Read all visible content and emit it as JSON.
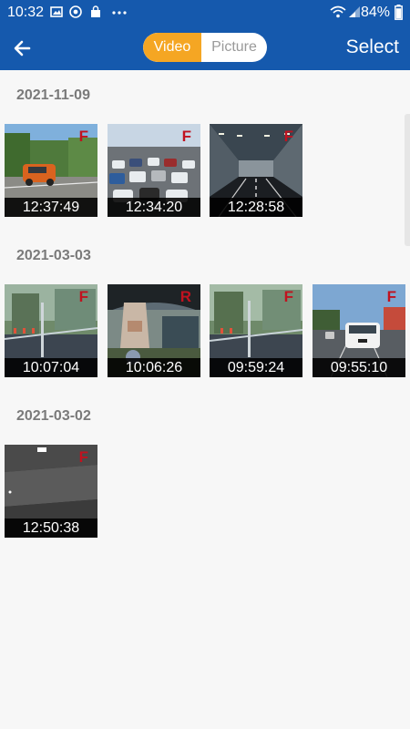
{
  "status": {
    "time": "10:32",
    "battery": "84%"
  },
  "header": {
    "tabs": [
      "Video",
      "Picture"
    ],
    "active_tab": "Video",
    "action": "Select"
  },
  "groups": [
    {
      "date": "2021-11-09",
      "items": [
        {
          "time": "12:37:49",
          "tag": "F",
          "scene": "suburban road with orange SUV"
        },
        {
          "time": "12:34:20",
          "tag": "F",
          "scene": "parking lot full of cars"
        },
        {
          "time": "12:28:58",
          "tag": "F",
          "scene": "tunnel interior"
        }
      ]
    },
    {
      "date": "2021-03-03",
      "items": [
        {
          "time": "10:07:04",
          "tag": "F",
          "scene": "view through windshield"
        },
        {
          "time": "10:06:26",
          "tag": "R",
          "scene": "rear interior view"
        },
        {
          "time": "09:59:24",
          "tag": "F",
          "scene": "view through windshield"
        },
        {
          "time": "09:55:10",
          "tag": "F",
          "scene": "road with white car ahead"
        }
      ]
    },
    {
      "date": "2021-03-02",
      "items": [
        {
          "time": "12:50:38",
          "tag": "F",
          "scene": "dark garage"
        }
      ]
    }
  ],
  "colors": {
    "appbar": "#1559ad",
    "accent": "#f5a623",
    "tag": "#c1121f"
  }
}
